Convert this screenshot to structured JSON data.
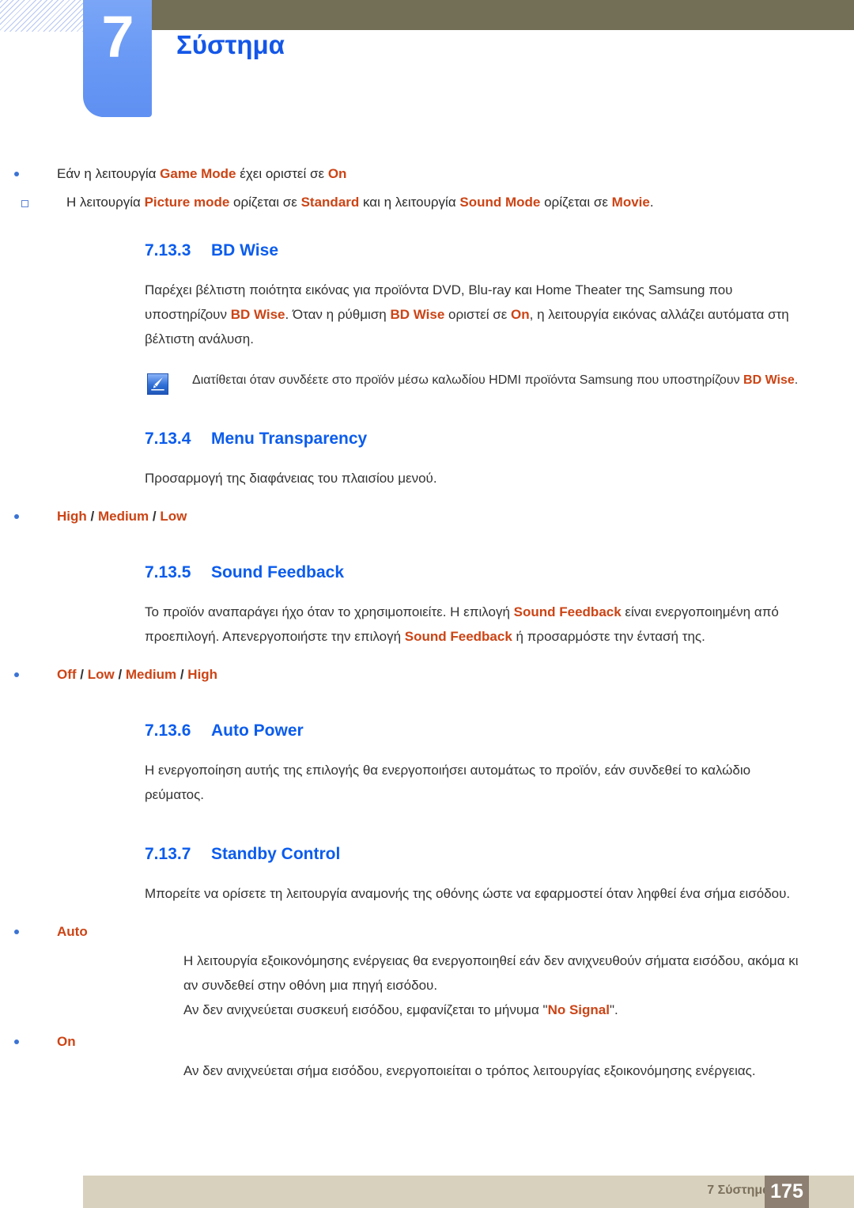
{
  "colors": {
    "heading_blue": "#0b5ced",
    "title_blue": "#1457e8",
    "accent_orange": "#cc4415",
    "tab_blue": "#6a9af5",
    "header_olive": "#736e56",
    "footer_beige": "#d8d1bd",
    "page_box_brown": "#8d7f71",
    "body_text": "#333333"
  },
  "header": {
    "chapter_number": "7",
    "chapter_title": "Σύστημα"
  },
  "intro_bullets": {
    "level1": {
      "pre": "Εάν η λειτουργία ",
      "term1": "Game Mode",
      "mid": " έχει οριστεί σε ",
      "term2": "On"
    },
    "level2": {
      "pre": "Η λειτουργία ",
      "term1": "Picture mode",
      "mid1": " ορίζεται σε ",
      "term2": "Standard",
      "mid2": " και η λειτουργία ",
      "term3": "Sound Mode",
      "mid3": " ορίζεται σε ",
      "term4": "Movie",
      "post": "."
    }
  },
  "sections": [
    {
      "number": "7.13.3",
      "title": "BD Wise",
      "paragraph": {
        "p1": "Παρέχει βέλτιστη ποιότητα εικόνας για προϊόντα DVD, Blu-ray και Home Theater της Samsung που υποστηρίζουν ",
        "t1": "BD Wise",
        "p2": ". Όταν η ρύθμιση ",
        "t2": "BD Wise",
        "p3": " οριστεί σε ",
        "t3": "On",
        "p4": ", η λειτουργία εικόνας αλλάζει αυτόματα στη βέλτιστη ανάλυση."
      },
      "note": {
        "icon": "note-pencil-icon",
        "p1": "Διατίθεται όταν συνδέετε στο προϊόν μέσω καλωδίου HDMI προϊόντα Samsung που υποστηρίζουν ",
        "t1": "BD Wise",
        "p2": "."
      }
    },
    {
      "number": "7.13.4",
      "title": "Menu Transparency",
      "paragraph": "Προσαρμογή της διαφάνειας του πλαισίου μενού.",
      "options": [
        "High",
        "Medium",
        "Low"
      ],
      "options_separator": " / "
    },
    {
      "number": "7.13.5",
      "title": "Sound Feedback",
      "paragraph": {
        "p1": "Το προϊόν αναπαράγει ήχο όταν το χρησιμοποιείτε. Η επιλογή ",
        "t1": "Sound Feedback",
        "p2": " είναι ενεργοποιημένη από προεπιλογή. Απενεργοποιήστε την επιλογή ",
        "t2": "Sound Feedback",
        "p3": " ή προσαρμόστε την έντασή της."
      },
      "options": [
        "Off",
        "Low",
        "Medium",
        "High"
      ],
      "options_separator": " / "
    },
    {
      "number": "7.13.6",
      "title": "Auto Power",
      "paragraph": "Η ενεργοποίηση αυτής της επιλογής θα ενεργοποιήσει αυτομάτως το προϊόν, εάν συνδεθεί το καλώδιο ρεύματος."
    },
    {
      "number": "7.13.7",
      "title": "Standby Control",
      "paragraph": "Μπορείτε να ορίσετε τη λειτουργία αναμονής της οθόνης ώστε να εφαρμοστεί όταν ληφθεί ένα σήμα εισόδου.",
      "items": [
        {
          "label": "Auto",
          "lines": [
            "Η λειτουργία εξοικονόμησης ενέργειας θα ενεργοποιηθεί εάν δεν ανιχνευθούν σήματα εισόδου, ακόμα κι αν συνδεθεί στην οθόνη μια πηγή εισόδου.",
            {
              "p1": "Αν δεν ανιχνεύεται συσκευή εισόδου, εμφανίζεται το μήνυμα \"",
              "t1": "No Signal",
              "p2": "\"."
            }
          ]
        },
        {
          "label": "On",
          "lines": [
            "Αν δεν ανιχνεύεται σήμα εισόδου, ενεργοποιείται ο τρόπος λειτουργίας εξοικονόμησης ενέργειας."
          ]
        }
      ]
    }
  ],
  "footer": {
    "label": "7 Σύστημα",
    "page_number": "175"
  }
}
